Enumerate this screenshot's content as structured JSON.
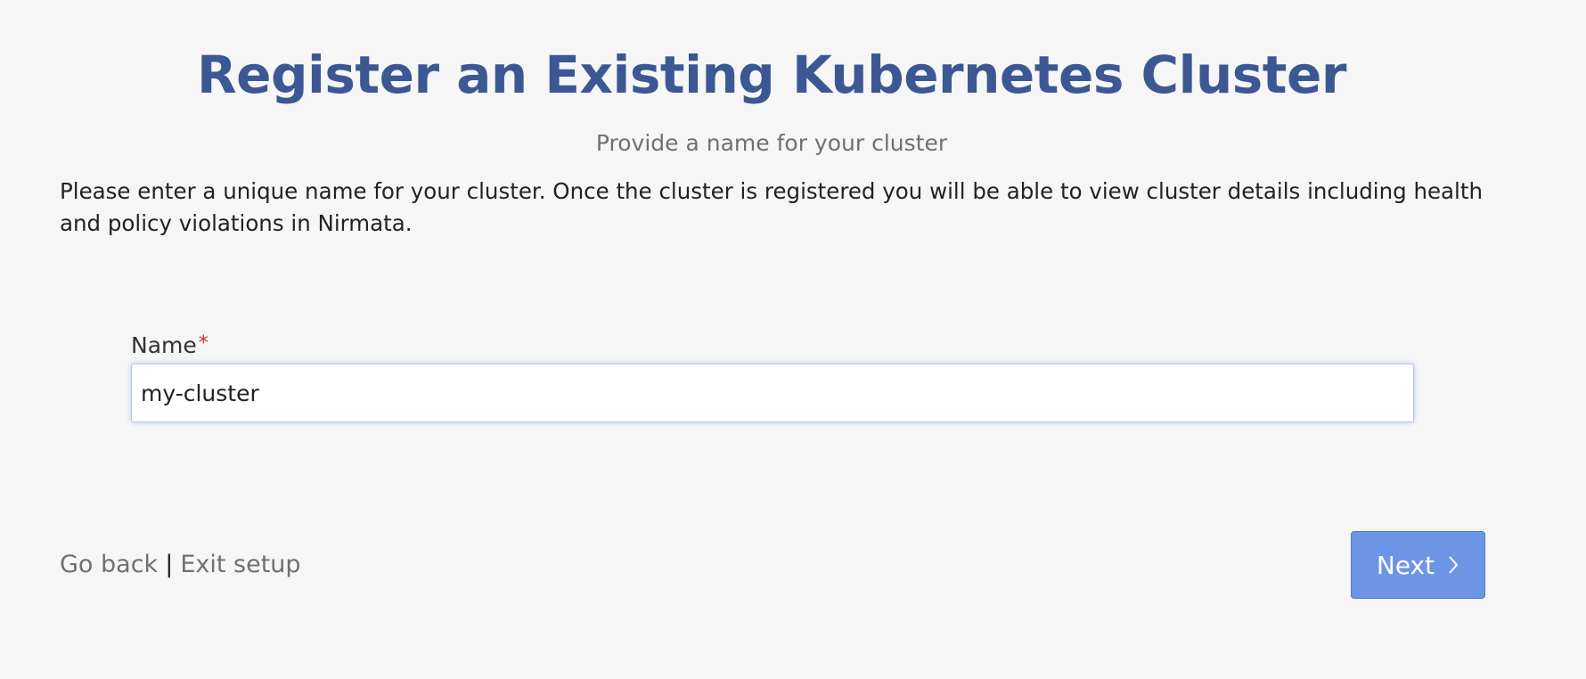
{
  "header": {
    "title": "Register an Existing Kubernetes Cluster",
    "subtitle": "Provide a name for your cluster"
  },
  "main": {
    "description": "Please enter a unique name for your cluster. Once the cluster is registered you will be able to view cluster details including health and policy violations in Nirmata.",
    "name_field": {
      "label": "Name",
      "required_marker": "*",
      "value": "my-cluster"
    }
  },
  "footer": {
    "go_back_label": "Go back",
    "separator": "|",
    "exit_setup_label": "Exit setup",
    "next_label": "Next"
  },
  "colors": {
    "title": "#3c5894",
    "primary_button": "#6d95e6",
    "required": "#c0392b"
  },
  "icons": {
    "next": "chevron-right-icon"
  }
}
